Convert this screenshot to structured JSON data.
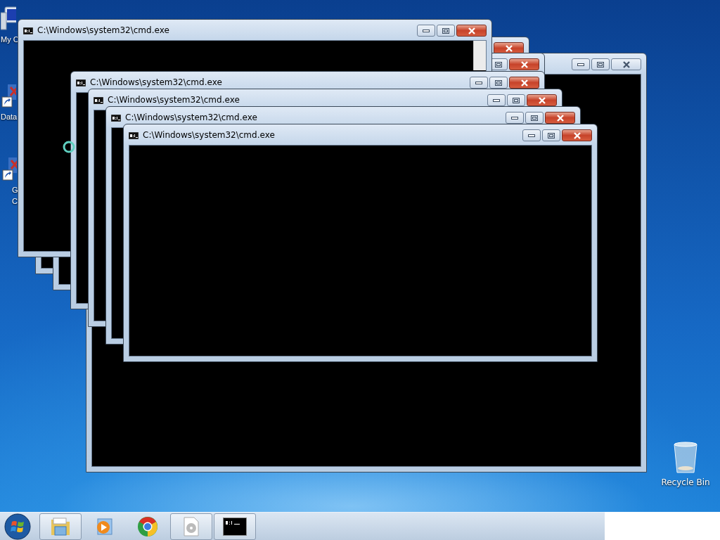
{
  "desktop_icons": [
    {
      "label_lines": [
        "My C"
      ],
      "kind": "computer"
    },
    {
      "label_lines": [
        "Data"
      ],
      "kind": "shortcut"
    },
    {
      "label_lines": [
        "G",
        "C"
      ],
      "kind": "shortcut"
    },
    {
      "label_lines": [
        "Recycle Bin"
      ],
      "kind": "bin"
    }
  ],
  "windows": [
    {
      "active": false
    },
    {
      "active": true
    },
    {
      "active": true
    },
    {
      "title": "C:\\Windows\\system32\\cmd.exe",
      "active": true,
      "scrollbar": true
    },
    {
      "title": "C:\\Windows\\system32\\cmd.exe",
      "active": true
    },
    {
      "title": "C:\\Windows\\system32\\cmd.exe",
      "active": true
    },
    {
      "title": "C:\\Windows\\system32\\cmd.exe",
      "active": true
    },
    {
      "title": "C:\\Windows\\system32\\cmd.exe",
      "active": true
    }
  ],
  "taskbar": {
    "items": [
      {
        "kind": "explorer",
        "running": true
      },
      {
        "kind": "media",
        "running": false
      },
      {
        "kind": "chrome",
        "running": false
      },
      {
        "kind": "disc",
        "running": true
      },
      {
        "kind": "cmd",
        "running": true
      }
    ]
  }
}
